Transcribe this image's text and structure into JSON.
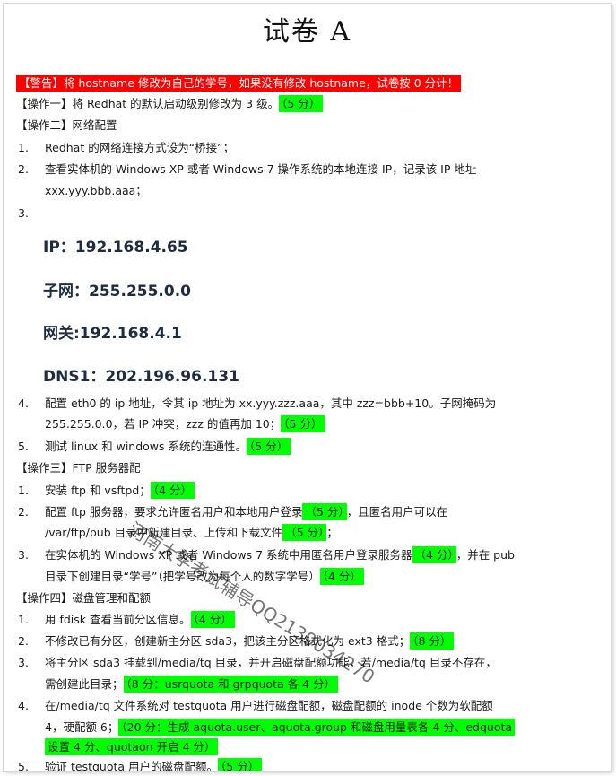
{
  "title": "试卷 A",
  "warning": "【警告】将 hostname 修改为自己的学号，如果没有修改 hostname，试卷按 0 分计！",
  "op1": {
    "text": "【操作一】将 Redhat 的默认启动级别修改为 3 级。",
    "score": "（5 分）"
  },
  "op2": {
    "heading": "【操作二】网络配置",
    "items": [
      {
        "num": "1.",
        "text": "Redhat 的网络连接方式设为“桥接”；"
      },
      {
        "num": "2.",
        "text": "查看实体机的 Windows XP 或者 Windows 7 操作系统的本地连接 IP，记录该 IP 地址",
        "text2": "xxx.yyy.bbb.aaa；"
      },
      {
        "num": "3.",
        "text": ""
      }
    ],
    "net": {
      "ip": "IP：192.168.4.65",
      "subnet": "子网：255.255.0.0",
      "gateway": "网关:192.168.4.1",
      "dns": "DNS1：202.196.96.131"
    },
    "item4": {
      "num": "4.",
      "text": "配置 eth0 的 ip 地址，令其 ip 地址为 xx.yyy.zzz.aaa，其中 zzz=bbb+10。子网掩码为",
      "text2": "255.255.0.0，若 IP 冲突，zzz 的值再加 10；",
      "score": "（5 分）"
    },
    "item5": {
      "num": "5.",
      "text": "测试 linux 和 windows 系统的连通性。",
      "score": "（5 分）"
    }
  },
  "op3": {
    "heading": "【操作三】FTP 服务器配",
    "item1": {
      "num": "1.",
      "text": "安装 ftp 和 vsftpd；",
      "score": "（4 分）"
    },
    "item2": {
      "num": "2.",
      "text": "配置 ftp 服务器，要求允许匿名用户和本地用户登录",
      "score": "（5 分）",
      "text_after": "，且匿名用户可以在",
      "text2": "/var/ftp/pub 目录中新建目录、上传和下载文件",
      "score2": "（5 分）",
      "tail2": "；"
    },
    "item3": {
      "num": "3.",
      "text": "在实体机的 Windows XP 或者 Windows 7 系统中用匿名用户登录服务器",
      "score": "（4 分）",
      "text_after": "，并在 pub",
      "text2": "目录下创建目录“学号”（把学号改为每个人的数字学号）",
      "score2": "（4 分）"
    }
  },
  "op4": {
    "heading": "【操作四】磁盘管理和配额",
    "item1": {
      "num": "1.",
      "text": "用 fdisk 查看当前分区信息。",
      "score": "（4 分）"
    },
    "item2": {
      "num": "2.",
      "text": "不修改已有分区，创建新主分区 sda3，把该主分区格式化为 ext3 格式；",
      "score": "（8 分）"
    },
    "item3": {
      "num": "3.",
      "text": "将主分区 sda3 挂载到/media/tq 目录，并开启磁盘配额功能，若/media/tq 目录不存在，",
      "text2": "需创建此目录；",
      "score": "（8 分：usrquota 和 grpquota 各 4 分）"
    },
    "item4": {
      "num": "4.",
      "text": "在/media/tq 文件系统对 testquota 用户进行磁盘配额，磁盘配额的 inode 个数为软配额",
      "text2": "4，硬配额 6；",
      "score": "（20 分：生成 aquota.user、aquota.group 和磁盘用量表各 4 分、edquota",
      "score_line2": "设置 4 分、quotaon 开启 4 分）"
    },
    "item5": {
      "num": "5.",
      "text": "验证 testquota 用户的磁盘配额。",
      "score": "（5 分）"
    }
  },
  "watermark": "河南大学考试辅导QQ2139034270",
  "colors": {
    "warning_bg": "#ff0000",
    "highlight": "#00ff00"
  }
}
